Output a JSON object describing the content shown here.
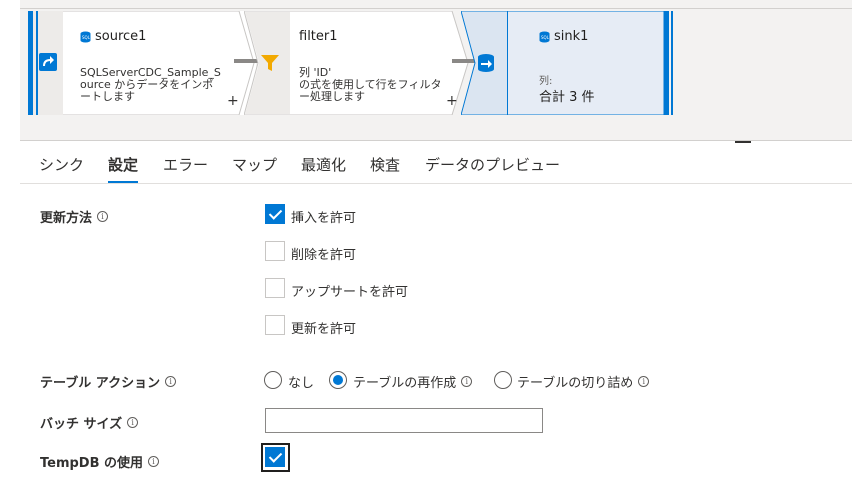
{
  "pipeline": {
    "source": {
      "title": "source1",
      "description": "SQLServerCDC_Sample_Source からデータをインポートします",
      "icon": "sql-db-icon"
    },
    "filter": {
      "title": "filter1",
      "description_line1": "列 'ID'",
      "description_line2": "の式を使用して行をフィルター処理します",
      "icon": "funnel-icon"
    },
    "sink": {
      "title": "sink1",
      "columns_label": "列:",
      "columns_value": "合計 3 件",
      "icon": "sql-db-icon"
    },
    "add_label": "+"
  },
  "tabs": [
    {
      "label": "シンク",
      "active": false
    },
    {
      "label": "設定",
      "active": true
    },
    {
      "label": "エラー",
      "active": false
    },
    {
      "label": "マップ",
      "active": false
    },
    {
      "label": "最適化",
      "active": false
    },
    {
      "label": "検査",
      "active": false
    },
    {
      "label": "データのプレビュー",
      "active": false
    }
  ],
  "settings": {
    "update_method": {
      "label": "更新方法",
      "options": [
        {
          "label": "挿入を許可",
          "checked": true
        },
        {
          "label": "削除を許可",
          "checked": false
        },
        {
          "label": "アップサートを許可",
          "checked": false
        },
        {
          "label": "更新を許可",
          "checked": false
        }
      ]
    },
    "table_action": {
      "label": "テーブル アクション",
      "options": [
        {
          "label": "なし",
          "selected": false
        },
        {
          "label": "テーブルの再作成",
          "selected": true
        },
        {
          "label": "テーブルの切り詰め",
          "selected": false
        }
      ]
    },
    "batch_size": {
      "label": "バッチ サイズ",
      "value": ""
    },
    "tempdb": {
      "label": "TempDB の使用",
      "checked": true
    },
    "info_glyph": "i"
  },
  "colors": {
    "accent": "#0078d4",
    "canvas_bg": "#f3f2f1",
    "node_selected_bg": "#e6ecf5"
  }
}
